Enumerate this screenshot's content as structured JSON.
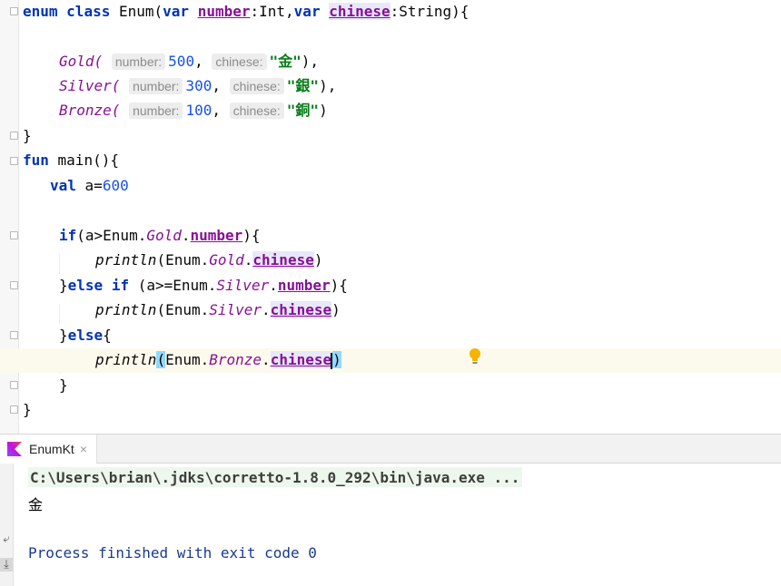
{
  "editor": {
    "lines": {
      "l1": {
        "kw1": "enum",
        "kw2": "class",
        "name": "Enum(",
        "kw3": "var",
        "p1": "number",
        "t1": ":Int,",
        "kw4": "var",
        "p2": "chinese",
        "t2": ":String){"
      },
      "l3": {
        "name": "Gold(",
        "hint1": "number:",
        "num": "500",
        "comma": ",",
        "hint2": "chinese:",
        "str": "\"金\"",
        "end": "),"
      },
      "l4": {
        "name": "Silver(",
        "hint1": "number:",
        "num": "300",
        "comma": ",",
        "hint2": "chinese:",
        "str": "\"銀\"",
        "end": "),"
      },
      "l5": {
        "name": "Bronze(",
        "hint1": "number:",
        "num": "100",
        "comma": ",",
        "hint2": "chinese:",
        "str": "\"銅\"",
        "end": ")"
      },
      "l6": {
        "text": "}"
      },
      "l7": {
        "kw": "fun",
        "rest": " main(){"
      },
      "l8": {
        "kw": "val",
        "rest": " a=",
        "num": "600"
      },
      "l10": {
        "kw": "if",
        "a": "(a>Enum.",
        "b": "Gold",
        ".": ".",
        "c": "number",
        "d": "){"
      },
      "l11": {
        "fn": "println",
        "a": "(Enum.",
        "b": "Gold",
        "dot": ".",
        "c": "chinese",
        "d": ")"
      },
      "l12": {
        "a": "}",
        "kw1": "else",
        "kw2": "if",
        "b": " (a>=Enum.",
        "c": "Silver",
        "dot": ".",
        "d": "number",
        "e": "){"
      },
      "l13": {
        "fn": "println",
        "a": "(Enum.",
        "b": "Silver",
        "dot": ".",
        "c": "chinese",
        "d": ")"
      },
      "l14": {
        "a": "}",
        "kw": "else",
        "b": "{"
      },
      "l15": {
        "fn": "println",
        "open": "(",
        "a": "Enum.",
        "b": "Bronze",
        "dot": ".",
        "c1": "chines",
        "c2": "e",
        "close": ")"
      },
      "l16": {
        "text": "}"
      },
      "l17": {
        "text": "}"
      }
    }
  },
  "run": {
    "tab_label": "EnumKt",
    "close": "×",
    "command": "C:\\Users\\brian\\.jdks\\corretto-1.8.0_292\\bin\\java.exe ...",
    "output": "金",
    "process": "Process finished with exit code 0"
  },
  "colors": {
    "keyword": "#0033b3",
    "number": "#1750eb",
    "string": "#067d17",
    "field": "#871094",
    "bulb": "#f4b400"
  }
}
